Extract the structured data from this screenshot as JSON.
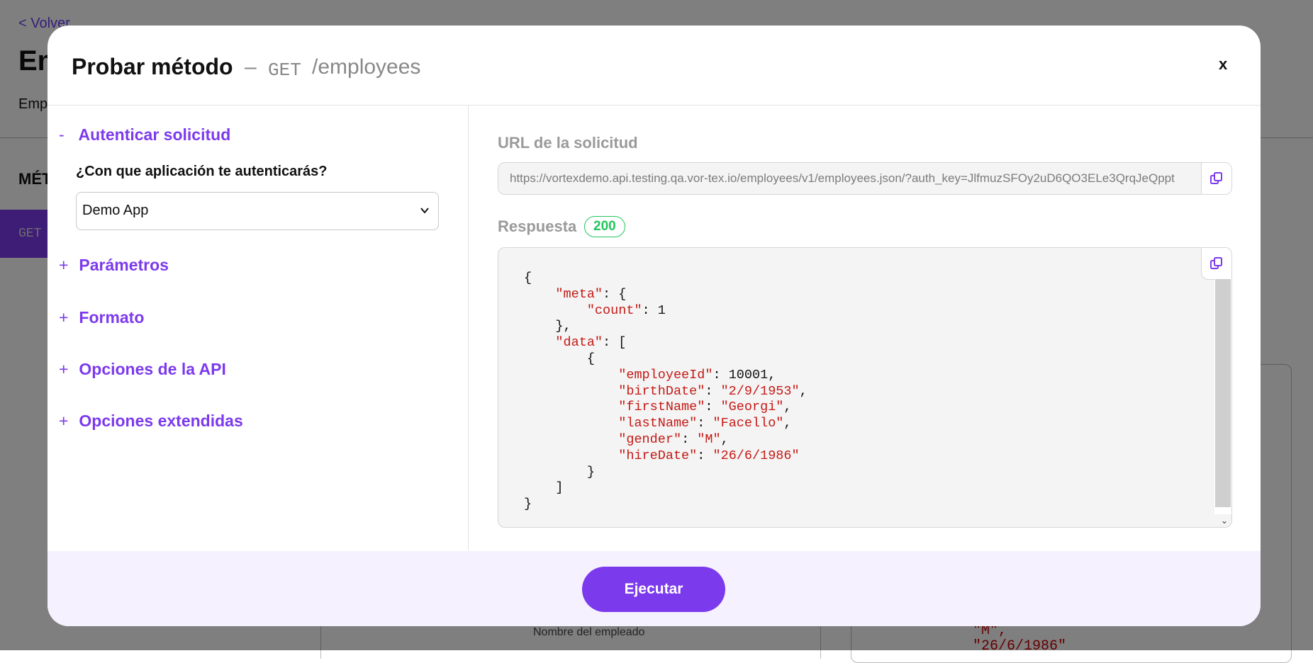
{
  "background": {
    "back_link": "< Volver",
    "title": "Em",
    "subtitle": "Emp",
    "section": "MÉT",
    "method": "GET",
    "field_label": "Nombre del empleado",
    "code_lines": [
      "\"M\",",
      "\"26/6/1986\""
    ]
  },
  "modal": {
    "title": "Probar método",
    "title_separator": "–",
    "method": "GET",
    "path": "/employees",
    "close_label": "x",
    "icons": {
      "close": "close-icon",
      "copy": "copy-icon",
      "chevron": "chevron-down-icon"
    }
  },
  "left": {
    "sections": [
      {
        "sign": "-",
        "label": "Autenticar solicitud",
        "expanded": true
      },
      {
        "sign": "+",
        "label": "Parámetros",
        "expanded": false
      },
      {
        "sign": "+",
        "label": "Formato",
        "expanded": false
      },
      {
        "sign": "+",
        "label": "Opciones de la API",
        "expanded": false
      },
      {
        "sign": "+",
        "label": "Opciones extendidas",
        "expanded": false
      }
    ],
    "auth_question": "¿Con que aplicación te autenticarás?",
    "app_selected": "Demo App"
  },
  "right": {
    "url_label": "URL de la solicitud",
    "url": "https://vortexdemo.api.testing.qa.vor-tex.io/employees/v1/employees.json/?auth_key=JlfmuzSFOy2uD6QO3ELe3QrqJeQppt",
    "response_label": "Respuesta",
    "status_code": "200",
    "response": {
      "meta_key": "\"meta\"",
      "count_key": "\"count\"",
      "count_value": "1",
      "data_key": "\"data\"",
      "fields": [
        {
          "key": "\"employeeId\"",
          "value": "10001",
          "string": false
        },
        {
          "key": "\"birthDate\"",
          "value": "\"2/9/1953\"",
          "string": true
        },
        {
          "key": "\"firstName\"",
          "value": "\"Georgi\"",
          "string": true
        },
        {
          "key": "\"lastName\"",
          "value": "\"Facello\"",
          "string": true
        },
        {
          "key": "\"gender\"",
          "value": "\"M\"",
          "string": true
        },
        {
          "key": "\"hireDate\"",
          "value": "\"26/6/1986\"",
          "string": true
        }
      ]
    }
  },
  "footer": {
    "execute_label": "Ejecutar"
  },
  "colors": {
    "accent": "#7c3aed",
    "status_ok": "#22c55e",
    "json_key": "#c41a16",
    "footer_bg": "#f5f1fe"
  }
}
